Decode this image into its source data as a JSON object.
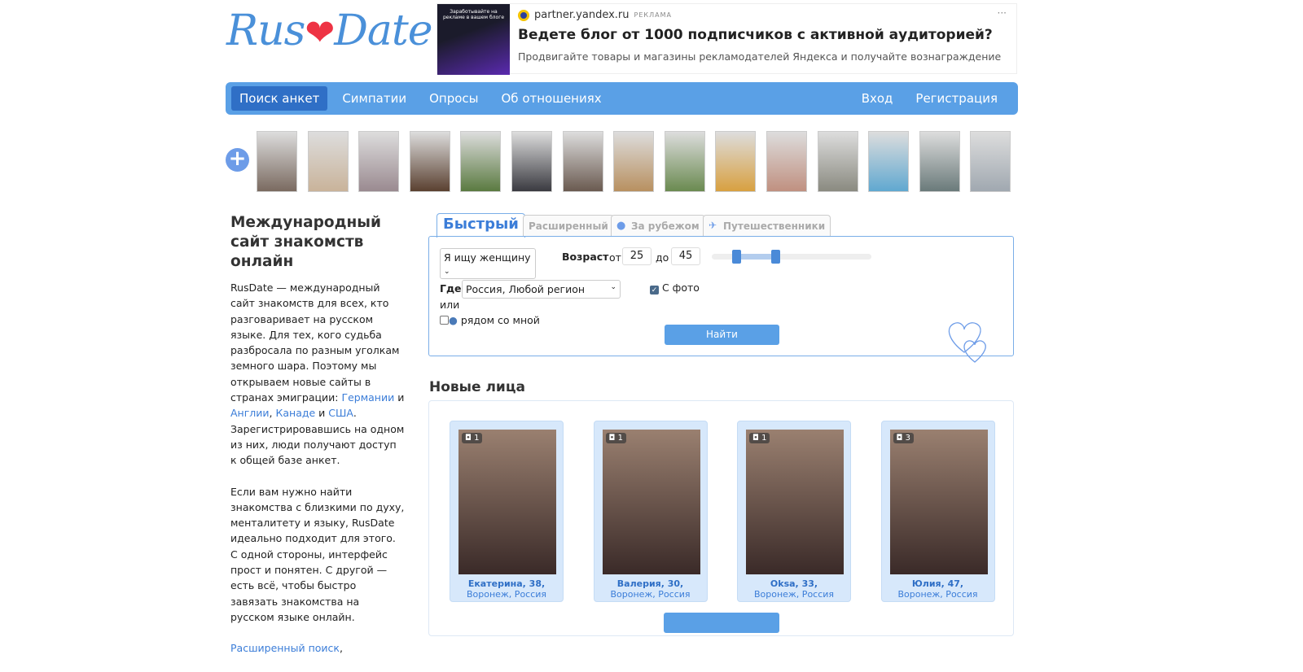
{
  "logo": {
    "left": "Rus",
    "right": "Date",
    "heart": "❤"
  },
  "ad": {
    "image_text": "Заработывайте на рекламе в вашем блоге",
    "source": "partner.yandex.ru",
    "label": "РЕКЛАМА",
    "title": "Ведете блог от 1000 подписчиков с активной аудиторией?",
    "text": "Продвигайте товары и магазины рекламодателей Яндекса и получайте вознаграждение",
    "menu": "···"
  },
  "nav": {
    "items": [
      "Поиск анкет",
      "Симпатии",
      "Опросы",
      "Об отношениях"
    ],
    "login": "Вход",
    "register": "Регистрация"
  },
  "strip": {
    "add": "+",
    "count": 15
  },
  "left": {
    "title": "Международный сайт знакомств онлайн",
    "p1a": "RusDate — международный сайт знакомств для всех, кто разговаривает на русском языке. Для тех, кого судьба разбросала по разным уголкам земного шара. Поэтому мы открываем новые сайты в странах эмиграции: ",
    "link_de": "Германии",
    "and1": " и ",
    "link_en": "Англии",
    "comma": ", ",
    "link_ca": "Канаде",
    "and2": " и ",
    "link_us": "США",
    "p1b": ". Зарегистрировавшись на одном из них, люди получают доступ к общей базе анкет.",
    "p2": "Если вам нужно найти знакомства с близкими по духу, менталитету и языку, RusDate идеально подходит для этого. С одной стороны, интерфейс прост и понятен. С другой — есть всё, чтобы быстро завязать знакомства на русском языке онлайн.",
    "link_adv": "Расширенный поиск",
    "after": ","
  },
  "tabs": [
    "Быстрый",
    "Расширенный",
    "За рубежом",
    "Путешественники"
  ],
  "form": {
    "seek": "Я ищу женщину",
    "age_label": "Возраст",
    "from": "от",
    "age_from": "25",
    "to": "до",
    "age_to": "45",
    "where": "Где",
    "region": "Россия, Любой регион",
    "with_photo": "С фото",
    "or": "или",
    "near_me": "рядом со мной",
    "submit": "Найти",
    "age_min": 18,
    "age_max": 99
  },
  "new_faces": {
    "title": "Новые лица",
    "cards": [
      {
        "name": "Екатерина, 38,",
        "location": "Воронеж, Россия",
        "photos": "1"
      },
      {
        "name": "Валерия, 30,",
        "location": "Воронеж, Россия",
        "photos": "1"
      },
      {
        "name": "Oksa, 33,",
        "location": "Воронеж, Россия",
        "photos": "1"
      },
      {
        "name": "Юлия, 47,",
        "location": "Воронеж, Россия",
        "photos": "3"
      }
    ]
  }
}
